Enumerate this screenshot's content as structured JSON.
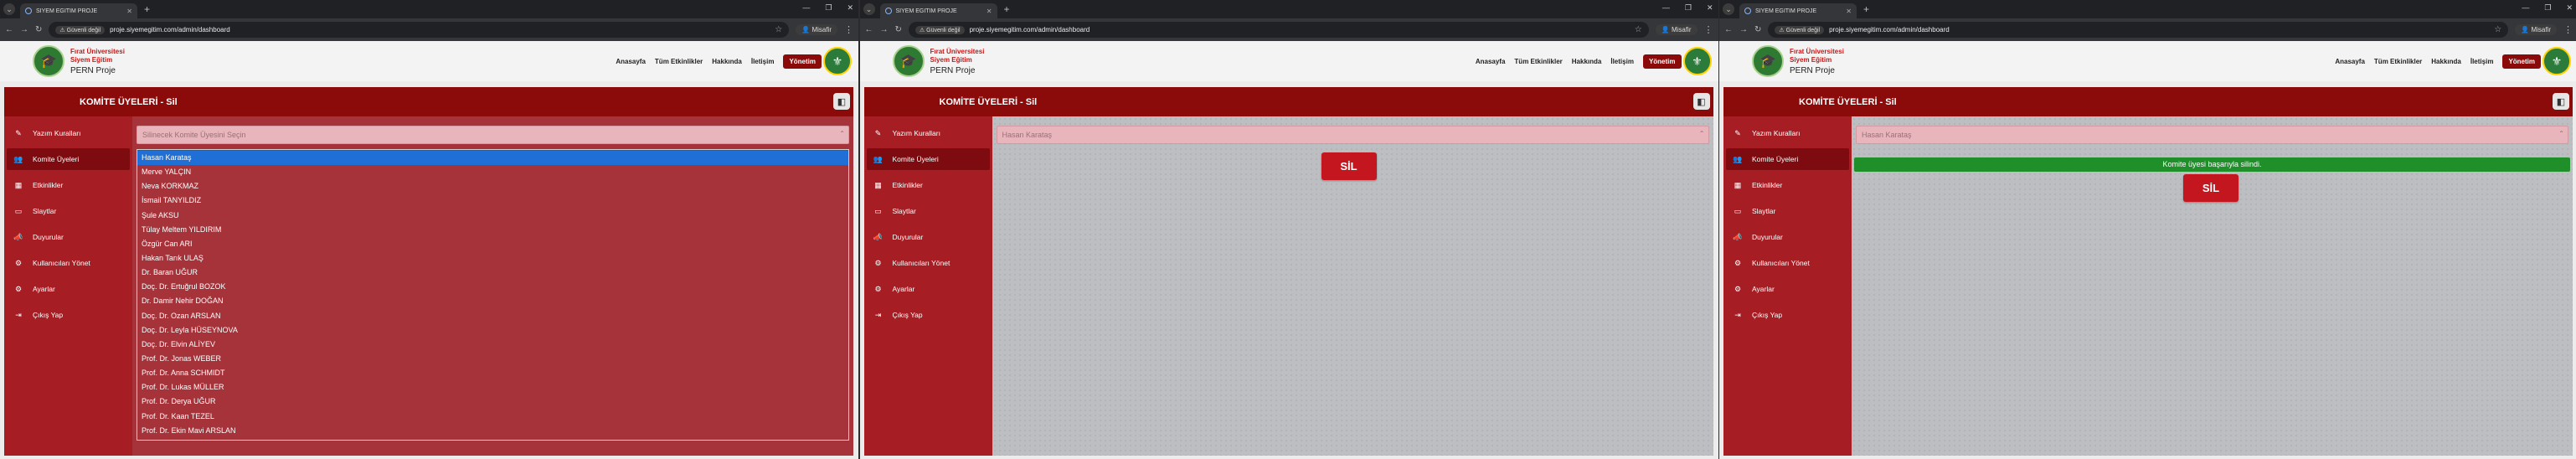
{
  "browser": {
    "tab_title": "SİYEM EGİTİM PROJE",
    "secure_label": "Güvenli değil",
    "url": "proje.siyemegitim.com/admin/dashboard",
    "guest_label": "Misafir"
  },
  "site": {
    "brand_line1": "Fırat Üniversitesi",
    "brand_line2": "Siyem Eğitim",
    "brand_line3": "PERN Proje",
    "nav": [
      "Anasayfa",
      "Tüm Etkinlikler",
      "Hakkında",
      "İletişim",
      "Yönetim"
    ]
  },
  "page": {
    "title": "KOMİTE ÜYELERİ - Sil",
    "collapse_icon": "collapse-icon"
  },
  "sidebar": {
    "items": [
      {
        "label": "Yazım Kuralları",
        "icon": "pen-icon"
      },
      {
        "label": "Komite Üyeleri",
        "icon": "users-icon"
      },
      {
        "label": "Etkinlikler",
        "icon": "calendar-icon"
      },
      {
        "label": "Slaytlar",
        "icon": "monitor-icon"
      },
      {
        "label": "Duyurular",
        "icon": "megaphone-icon"
      },
      {
        "label": "Kullanıcıları Yönet",
        "icon": "user-cog-icon"
      },
      {
        "label": "Ayarlar",
        "icon": "gear-icon"
      },
      {
        "label": "Çıkış Yap",
        "icon": "logout-icon"
      }
    ]
  },
  "panel1": {
    "placeholder": "Silinecek Komite Üyesini Seçin",
    "options": [
      "Hasan Karataş",
      "Merve YALÇIN",
      "Neva KORKMAZ",
      "İsmail TANYILDIZ",
      "Şule AKSU",
      "Tülay Meltem YILDIRIM",
      "Özgür Can ARI",
      "Hakan Tarık ULAŞ",
      "Dr. Baran UĞUR",
      "Doç. Dr. Ertuğrul BOZOK",
      "Dr. Damir Nehir DOĞAN",
      "Doç. Dr. Ozan ARSLAN",
      "Doç. Dr. Leyla HÜSEYNOVA",
      "Doç. Dr. Elvin ALİYEV",
      "Prof. Dr. Jonas WEBER",
      "Prof. Dr. Anna SCHMIDT",
      "Prof. Dr. Lukas MÜLLER",
      "Prof. Dr. Derya UĞUR",
      "Prof. Dr. Kaan TEZEL",
      "Prof. Dr. Ekin Mavi ARSLAN"
    ]
  },
  "panel2": {
    "selected_value": "Hasan Karataş",
    "delete_label": "SİL"
  },
  "panel3": {
    "selected_value": "Hasan Karataş",
    "success_message": "Komite üyesi başarıyla silindi.",
    "delete_label": "SİL"
  }
}
